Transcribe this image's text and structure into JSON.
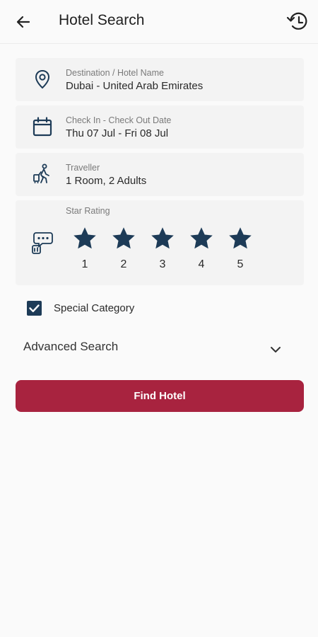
{
  "header": {
    "title": "Hotel Search"
  },
  "form": {
    "destination": {
      "label": "Destination / Hotel Name",
      "value": "Dubai - United Arab Emirates"
    },
    "dates": {
      "label": "Check In - Check Out Date",
      "value": "Thu 07 Jul - Fri 08 Jul"
    },
    "traveller": {
      "label": "Traveller",
      "value": "1 Room, 2 Adults"
    },
    "star_rating": {
      "label": "Star Rating",
      "options": [
        "1",
        "2",
        "3",
        "4",
        "5"
      ]
    },
    "special_category": {
      "label": "Special Category",
      "checked": true
    },
    "advanced_search": {
      "label": "Advanced Search"
    },
    "submit_label": "Find Hotel"
  },
  "icons": {
    "back": "arrow-left-icon",
    "history": "history-icon",
    "destination": "map-pin-icon",
    "dates": "calendar-icon",
    "traveller": "traveller-luggage-icon",
    "rating": "review-chat-icon",
    "star": "star-icon",
    "checkbox": "checkbox-checked-icon",
    "expand": "chevron-down-icon"
  },
  "colors": {
    "primary_navy": "#1d3b57",
    "accent_red": "#a8233f",
    "field_bg": "#f3f3f3",
    "page_bg": "#fafafa"
  }
}
